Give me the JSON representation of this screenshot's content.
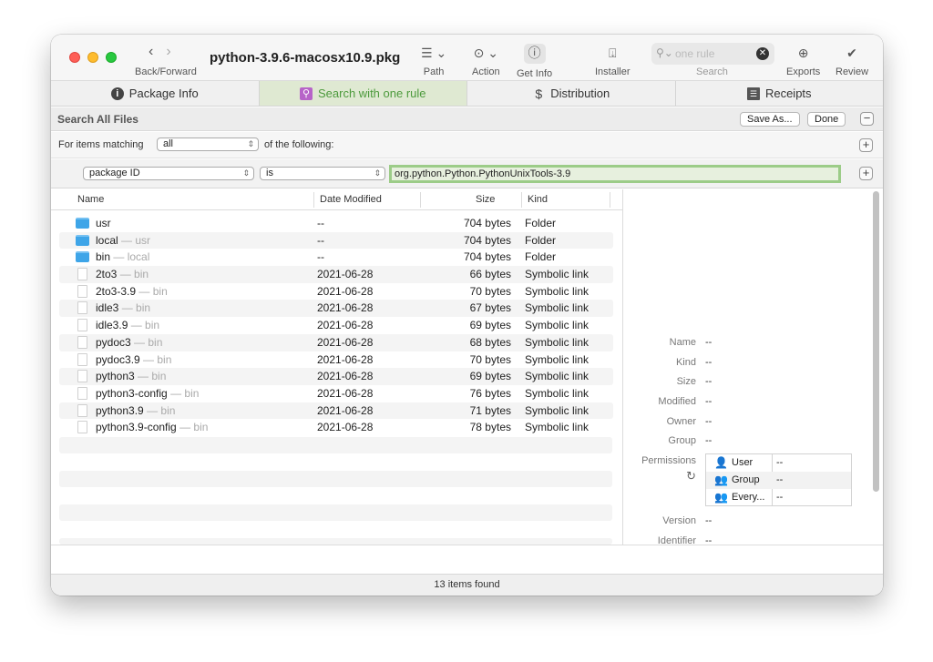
{
  "window": {
    "title": "python-3.9.6-macosx10.9.pkg",
    "nav_label": "Back/Forward"
  },
  "toolbar": {
    "path_label": "Path",
    "action_label": "Action",
    "getinfo_label": "Get Info",
    "installer_label": "Installer",
    "search_placeholder": "one rule",
    "search_label": "Search",
    "exports_label": "Exports",
    "review_label": "Review"
  },
  "tabs": [
    {
      "label": "Package Info",
      "icon": "info-icon"
    },
    {
      "label": "Search with one rule",
      "icon": "search-folder-icon",
      "active": true
    },
    {
      "label": "Distribution",
      "icon": "distribution-icon"
    },
    {
      "label": "Receipts",
      "icon": "receipts-icon"
    }
  ],
  "searchbar": {
    "title": "Search All Files",
    "save_as_label": "Save As...",
    "done_label": "Done"
  },
  "rules": {
    "prefix": "For items matching",
    "match_mode": "all",
    "suffix": "of the following:",
    "field": "package ID",
    "operator": "is",
    "value": "org.python.Python.PythonUnixTools-3.9"
  },
  "file_list": {
    "columns": [
      "Name",
      "Date Modified",
      "Size",
      "Kind"
    ],
    "rows": [
      {
        "name": "usr",
        "parent": "",
        "date": "--",
        "size": "704 bytes",
        "kind": "Folder",
        "type": "folder"
      },
      {
        "name": "local",
        "parent": "— usr",
        "date": "--",
        "size": "704 bytes",
        "kind": "Folder",
        "type": "folder"
      },
      {
        "name": "bin",
        "parent": "— local",
        "date": "--",
        "size": "704 bytes",
        "kind": "Folder",
        "type": "folder"
      },
      {
        "name": "2to3",
        "parent": "— bin",
        "date": "2021-06-28",
        "size": "66 bytes",
        "kind": "Symbolic link",
        "type": "link"
      },
      {
        "name": "2to3-3.9",
        "parent": "— bin",
        "date": "2021-06-28",
        "size": "70 bytes",
        "kind": "Symbolic link",
        "type": "link"
      },
      {
        "name": "idle3",
        "parent": "— bin",
        "date": "2021-06-28",
        "size": "67 bytes",
        "kind": "Symbolic link",
        "type": "link"
      },
      {
        "name": "idle3.9",
        "parent": "— bin",
        "date": "2021-06-28",
        "size": "69 bytes",
        "kind": "Symbolic link",
        "type": "link"
      },
      {
        "name": "pydoc3",
        "parent": "— bin",
        "date": "2021-06-28",
        "size": "68 bytes",
        "kind": "Symbolic link",
        "type": "link"
      },
      {
        "name": "pydoc3.9",
        "parent": "— bin",
        "date": "2021-06-28",
        "size": "70 bytes",
        "kind": "Symbolic link",
        "type": "link"
      },
      {
        "name": "python3",
        "parent": "— bin",
        "date": "2021-06-28",
        "size": "69 bytes",
        "kind": "Symbolic link",
        "type": "link"
      },
      {
        "name": "python3-config",
        "parent": "— bin",
        "date": "2021-06-28",
        "size": "76 bytes",
        "kind": "Symbolic link",
        "type": "link"
      },
      {
        "name": "python3.9",
        "parent": "— bin",
        "date": "2021-06-28",
        "size": "71 bytes",
        "kind": "Symbolic link",
        "type": "link"
      },
      {
        "name": "python3.9-config",
        "parent": "— bin",
        "date": "2021-06-28",
        "size": "78 bytes",
        "kind": "Symbolic link",
        "type": "link"
      }
    ]
  },
  "info": {
    "name_label": "Name",
    "name_value": "--",
    "kind_label": "Kind",
    "kind_value": "--",
    "size_label": "Size",
    "size_value": "--",
    "modified_label": "Modified",
    "modified_value": "--",
    "owner_label": "Owner",
    "owner_value": "--",
    "group_label": "Group",
    "group_value": "--",
    "permissions_label": "Permissions",
    "permissions": [
      {
        "who": "User",
        "value": "--"
      },
      {
        "who": "Group",
        "value": "--"
      },
      {
        "who": "Every...",
        "value": "--"
      }
    ],
    "version_label": "Version",
    "version_value": "--",
    "identifier_label": "Identifier",
    "identifier_value": "--"
  },
  "status": {
    "text": "13 items found"
  },
  "colors": {
    "accent": "#4c9a3c",
    "active_tab_bg": "#dfe9d2",
    "rule_highlight": "#9ccc88",
    "folder": "#3ea5e8"
  }
}
